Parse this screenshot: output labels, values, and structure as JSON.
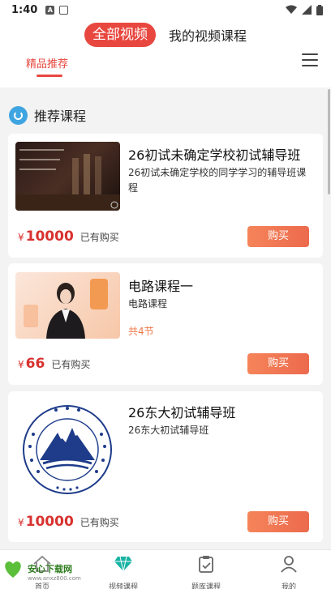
{
  "status_bar": {
    "time": "1:40",
    "left_icons": [
      "a-icon",
      "sim-icon"
    ],
    "right_icons": [
      "wifi-icon",
      "signal-icon",
      "battery-icon"
    ]
  },
  "top_nav": {
    "active": "全部视频",
    "other": "我的视频课程"
  },
  "sub_tab": {
    "label": "精品推荐"
  },
  "section": {
    "title": "推荐课程"
  },
  "courses": [
    {
      "title": "26初试未确定学校初试辅导班",
      "desc": "26初试未确定学校的同学学习的辅导班课程",
      "extra": "",
      "currency": "¥",
      "price": "10000",
      "bought": "已有购买",
      "buy_label": "购买"
    },
    {
      "title": "电路课程一",
      "desc": "电路课程",
      "extra": "共4节",
      "currency": "¥",
      "price": "66",
      "bought": "已有购买",
      "buy_label": "购买"
    },
    {
      "title": "26东大初试辅导班",
      "desc": "26东大初试辅导班",
      "extra": "",
      "currency": "¥",
      "price": "10000",
      "bought": "已有购买",
      "buy_label": "购买"
    }
  ],
  "bottom_nav": [
    {
      "label": "首页",
      "icon": "home-icon"
    },
    {
      "label": "视频课程",
      "icon": "diamond-icon"
    },
    {
      "label": "题库课程",
      "icon": "clipboard-icon"
    },
    {
      "label": "我的",
      "icon": "user-icon"
    }
  ],
  "watermark": {
    "text": "安心下载网",
    "url": "www.anxz800.com"
  },
  "colors": {
    "accent": "#e8473f",
    "price": "#d8322f",
    "button": "#f07a4a"
  }
}
